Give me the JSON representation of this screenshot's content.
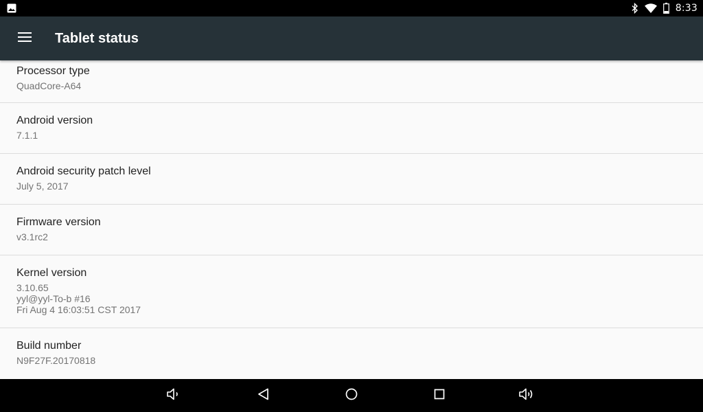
{
  "status_bar": {
    "time": "8:33",
    "left_icon": "image-notification-icon",
    "right_icons": [
      "bluetooth-icon",
      "wifi-icon",
      "battery-icon"
    ]
  },
  "app_bar": {
    "menu_icon": "menu-icon",
    "title": "Tablet status"
  },
  "items": [
    {
      "title": "Processor type",
      "summary": "QuadCore-A64"
    },
    {
      "title": "Android version",
      "summary": "7.1.1"
    },
    {
      "title": "Android security patch level",
      "summary": "July 5, 2017"
    },
    {
      "title": "Firmware version",
      "summary": "v3.1rc2"
    },
    {
      "title": "Kernel version",
      "summary": "3.10.65\nyyl@yyl-To-b #16\nFri Aug 4 16:03:51 CST 2017"
    },
    {
      "title": "Build number",
      "summary": "N9F27F.20170818"
    }
  ],
  "nav_bar": {
    "buttons": [
      "volume-down-icon",
      "back-icon",
      "home-icon",
      "recents-icon",
      "volume-up-icon"
    ]
  },
  "colors": {
    "status_bar": "#000000",
    "app_bar": "#263238",
    "background": "#fafafa",
    "title_text": "#212121",
    "summary_text": "#737373"
  }
}
